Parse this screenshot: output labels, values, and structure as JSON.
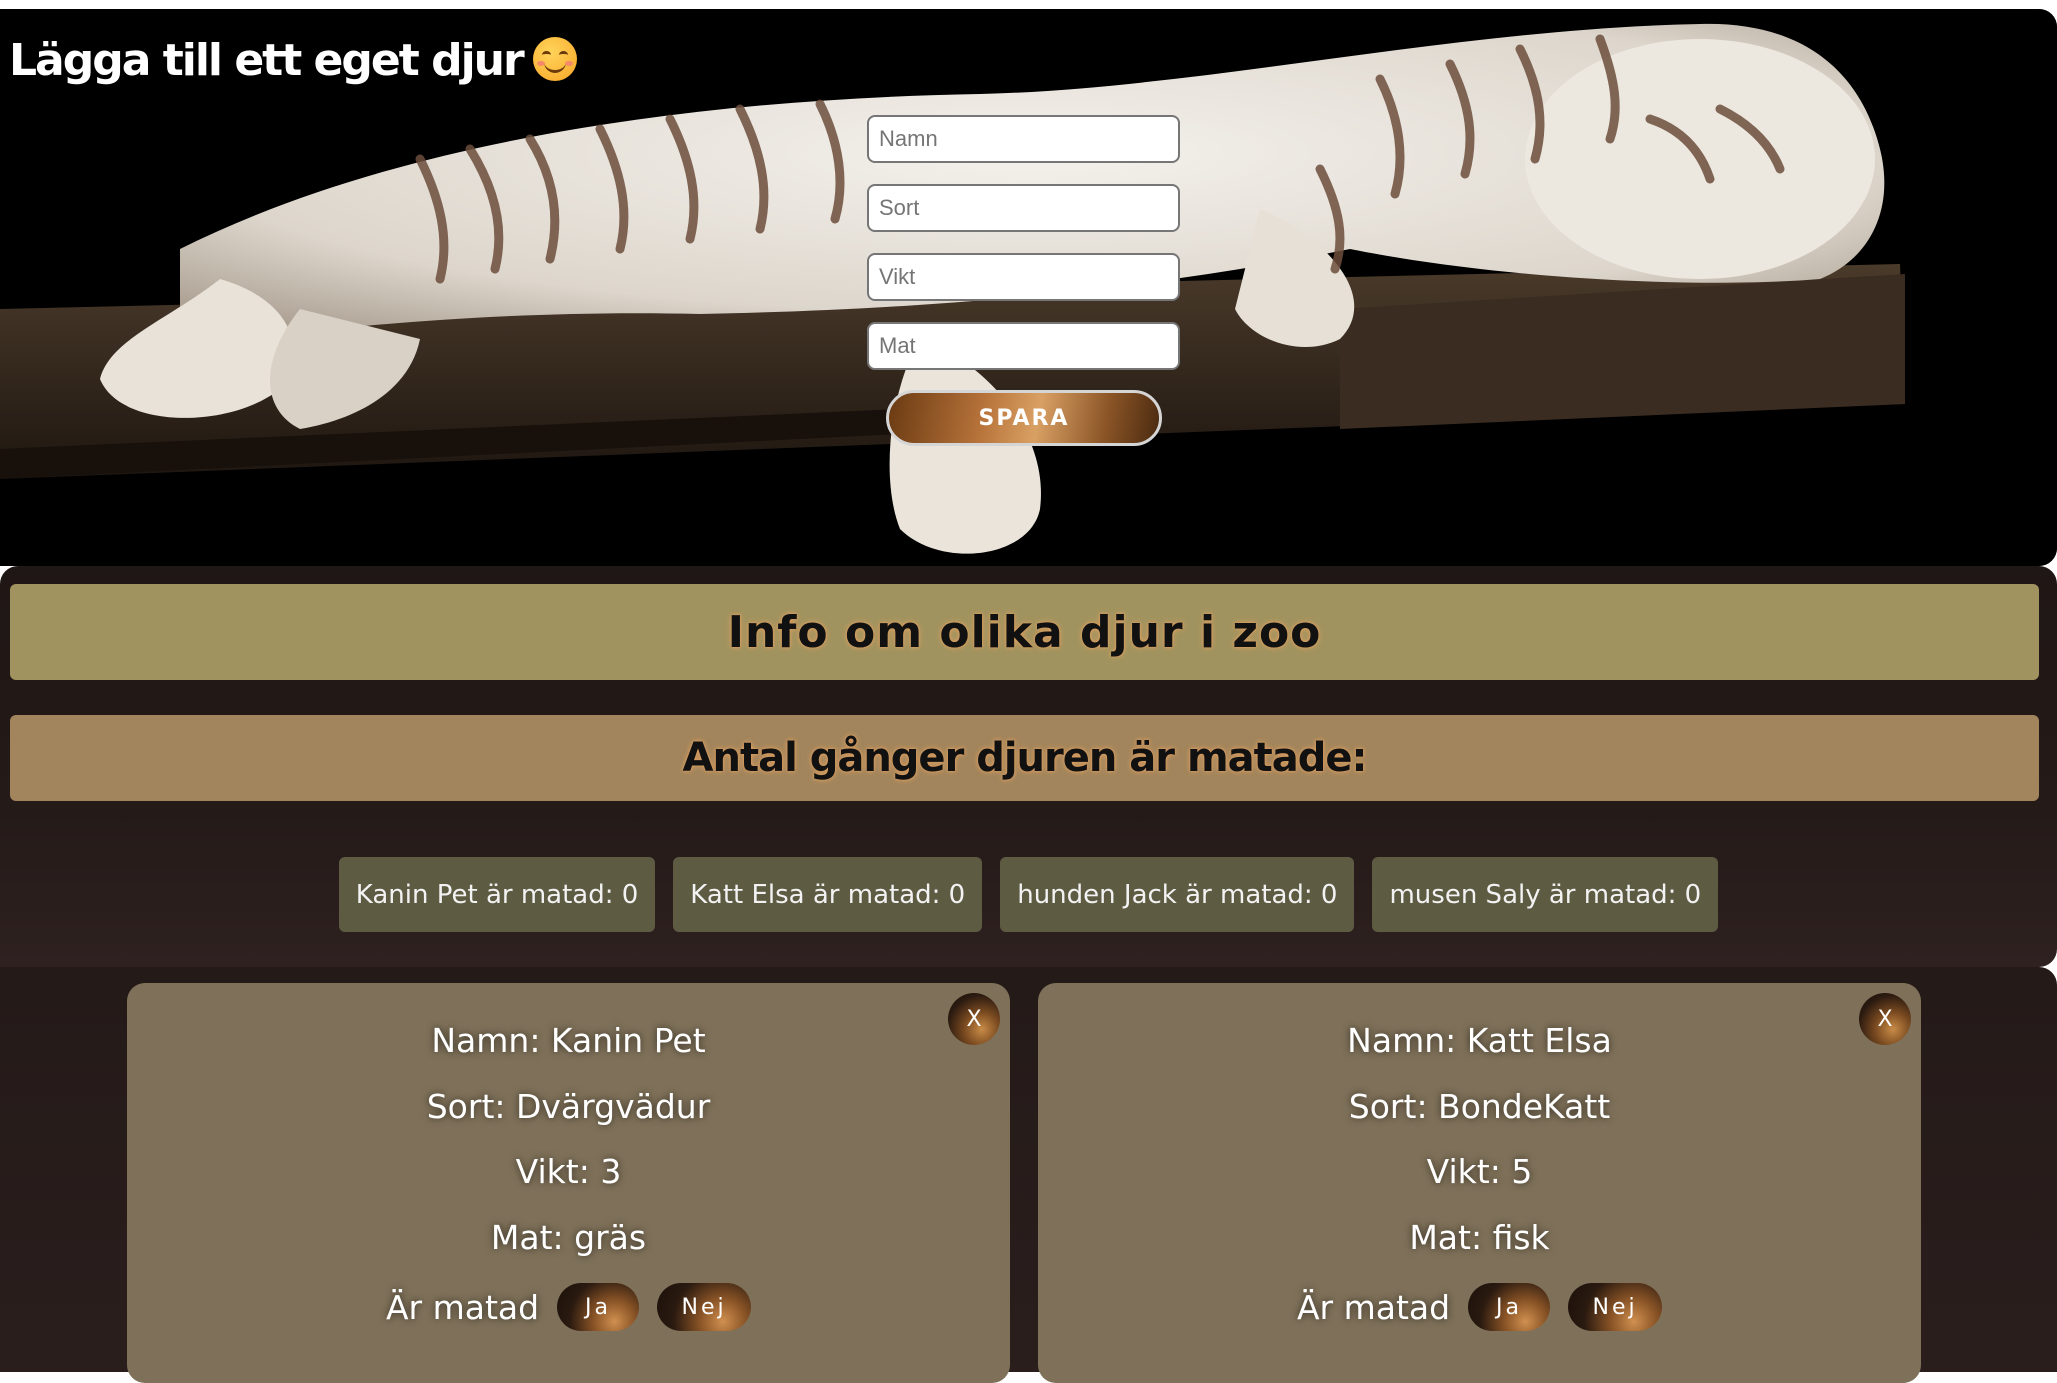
{
  "form": {
    "title": "Lägga till ett eget djur",
    "title_icon": "smiling-face-emoji",
    "name_placeholder": "Namn",
    "sort_placeholder": "Sort",
    "vikt_placeholder": "Vikt",
    "mat_placeholder": "Mat",
    "save_label": "SPARA"
  },
  "info": {
    "heading": "Info om olika djur i zoo",
    "fed_heading": "Antal gånger djuren är matade:",
    "fed_counts": [
      {
        "label": "Kanin Pet är matad: 0"
      },
      {
        "label": "Katt Elsa är matad: 0"
      },
      {
        "label": "hunden Jack är matad: 0"
      },
      {
        "label": "musen Saly är matad: 0"
      }
    ]
  },
  "animals": [
    {
      "close_label": "X",
      "namn": "Namn: Kanin Pet",
      "sort": "Sort: Dvärgvädur",
      "vikt": "Vikt: 3",
      "mat": "Mat: gräs",
      "fed_label": "Är matad",
      "yes_label": "Ja",
      "no_label": "Nej"
    },
    {
      "close_label": "X",
      "namn": "Namn: Katt Elsa",
      "sort": "Sort: BondeKatt",
      "vikt": "Vikt: 5",
      "mat": "Mat: fisk",
      "fed_label": "Är matad",
      "yes_label": "Ja",
      "no_label": "Nej"
    }
  ],
  "colors": {
    "info_band": "#a1935f",
    "fed_band": "#a2855c",
    "pill": "#5e5b43",
    "card": "#7f7159",
    "section_bg": "#221816"
  }
}
